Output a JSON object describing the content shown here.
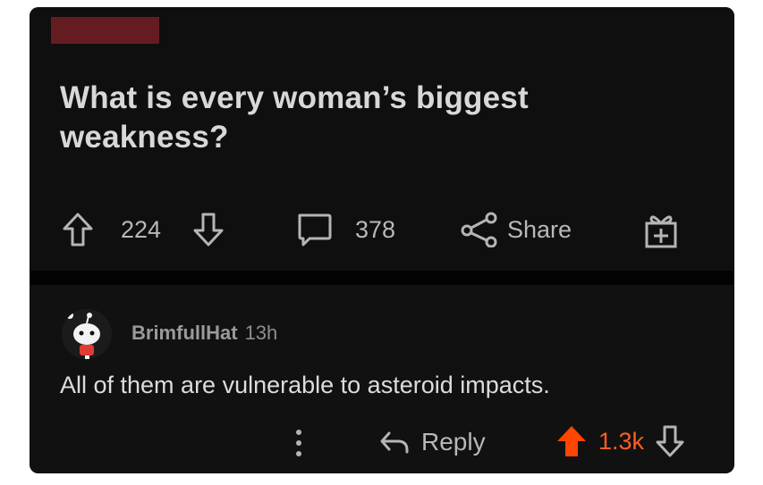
{
  "post": {
    "title": "What is every woman’s biggest weakness?",
    "upvotes": "224",
    "comments": "378",
    "share_label": "Share"
  },
  "comment": {
    "author": "BrimfullHat",
    "time": "13h",
    "text": "All of them are vulnerable to asteroid impacts.",
    "reply_label": "Reply",
    "score": "1.3k"
  },
  "colors": {
    "accent_upvote": "#ff4500",
    "redaction": "#6e1e23",
    "background": "#0f0f0f"
  },
  "icons": [
    "upvote-icon",
    "downvote-icon",
    "comment-icon",
    "share-icon",
    "award-icon",
    "more-icon",
    "reply-icon"
  ]
}
